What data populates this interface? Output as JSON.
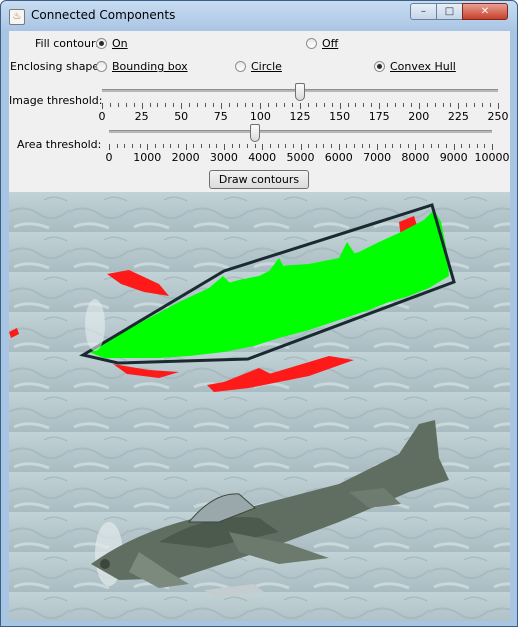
{
  "window": {
    "title": "Connected Components",
    "app_icon": "java-icon",
    "controls": {
      "minimize": "–",
      "maximize": "□",
      "close": "✕"
    }
  },
  "fill_contour": {
    "label": "Fill contour:",
    "options": [
      {
        "text": "On",
        "selected": true
      },
      {
        "text": "Off",
        "selected": false
      }
    ]
  },
  "enclosing_shape": {
    "label": "Enclosing shape:",
    "options": [
      {
        "text": "Bounding box",
        "selected": false
      },
      {
        "text": "Circle",
        "selected": false
      },
      {
        "text": "Convex Hull",
        "selected": true
      }
    ]
  },
  "image_threshold": {
    "label": "Image threshold:",
    "value": 125,
    "min": 0,
    "max": 250,
    "tick_labels": [
      "0",
      "25",
      "50",
      "75",
      "100",
      "125",
      "150",
      "175",
      "200",
      "225",
      "250"
    ]
  },
  "area_threshold": {
    "label": "Area threshold:",
    "value": 3800,
    "min": 0,
    "max": 10000,
    "tick_labels": [
      "0",
      "1000",
      "2000",
      "3000",
      "4000",
      "5000",
      "6000",
      "7000",
      "8000",
      "9000",
      "10000"
    ]
  },
  "draw_button": {
    "label": "Draw contours"
  },
  "colors": {
    "fill": "#00ff00",
    "hull": "#1a2a30",
    "red_regions": "#ff1a1a",
    "sky": "#b7c9ce"
  }
}
